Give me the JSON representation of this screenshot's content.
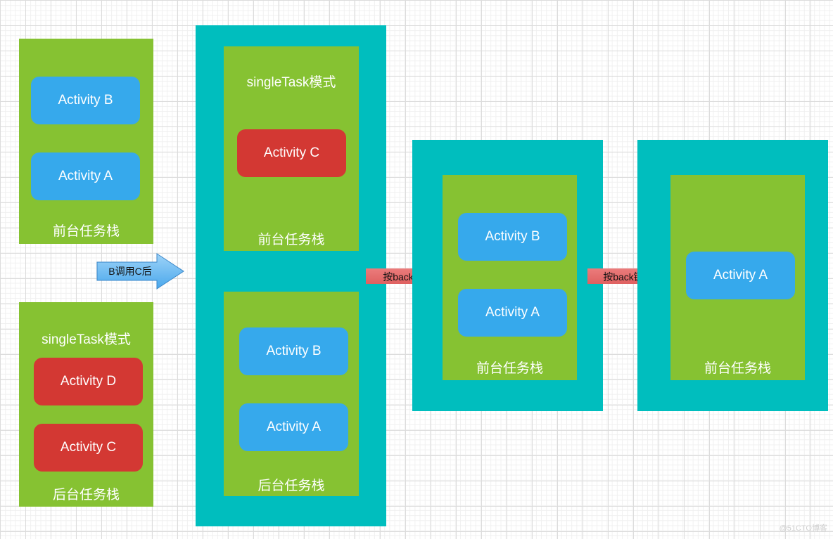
{
  "colors": {
    "teal": "#00BEBE",
    "green": "#86C232",
    "blue": "#36A9EC",
    "red": "#D33833",
    "arrow_blue": "#5AB4F0",
    "arrow_red": "#E06666"
  },
  "initial": {
    "foreground": {
      "label": "前台任务栈",
      "activities": [
        "Activity B",
        "Activity A"
      ]
    },
    "background": {
      "mode": "singleTask模式",
      "label": "后台任务栈",
      "activities": [
        "Activity D",
        "Activity C"
      ]
    }
  },
  "arrow1": {
    "label": "B调用C后"
  },
  "after_call": {
    "foreground": {
      "mode": "singleTask模式",
      "label": "前台任务栈",
      "activities": [
        "Activity C"
      ]
    },
    "background": {
      "label": "后台任务栈",
      "activities": [
        "Activity B",
        "Activity A"
      ]
    }
  },
  "arrow2": {
    "label": "按back键"
  },
  "after_back1": {
    "foreground": {
      "label": "前台任务栈",
      "activities": [
        "Activity B",
        "Activity A"
      ]
    }
  },
  "arrow3": {
    "label": "按back键"
  },
  "after_back2": {
    "foreground": {
      "label": "前台任务栈",
      "activities": [
        "Activity A"
      ]
    }
  },
  "watermark": "@51CTO博客"
}
